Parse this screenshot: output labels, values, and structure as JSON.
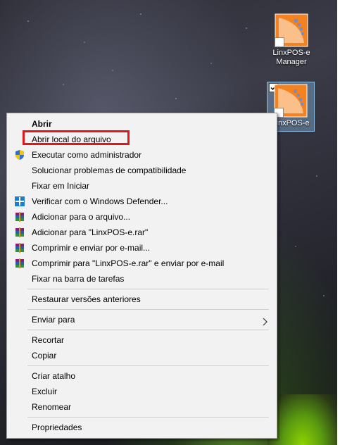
{
  "desktop": {
    "icons": [
      {
        "label_line1": "LinxPOS-e",
        "label_line2": "Manager",
        "icon": "linxpos-app-icon"
      },
      {
        "label_line1": "LinxPOS-e",
        "icon": "linxpos-app-icon",
        "selected": true
      }
    ]
  },
  "context_menu": {
    "items": [
      {
        "label": "Abrir",
        "bold": true
      },
      {
        "label": "Abrir local do arquivo",
        "highlighted": true
      },
      {
        "label": "Executar como administrador",
        "icon": "uac-shield-icon"
      },
      {
        "label": "Solucionar problemas de compatibilidade"
      },
      {
        "label": "Fixar em Iniciar"
      },
      {
        "label": "Verificar com o Windows Defender...",
        "icon": "windows-defender-icon"
      },
      {
        "label": "Adicionar para o arquivo...",
        "icon": "winrar-icon"
      },
      {
        "label": "Adicionar para \"LinxPOS-e.rar\"",
        "icon": "winrar-icon"
      },
      {
        "label": "Comprimir e enviar por e-mail...",
        "icon": "winrar-icon"
      },
      {
        "label": "Comprimir para \"LinxPOS-e.rar\" e enviar por e-mail",
        "icon": "winrar-icon"
      },
      {
        "label": "Fixar na barra de tarefas"
      },
      {
        "label": "Restaurar versões anteriores"
      },
      {
        "label": "Enviar para",
        "submenu": true,
        "icon": "chevron-right-icon"
      },
      {
        "label": "Recortar"
      },
      {
        "label": "Copiar"
      },
      {
        "label": "Criar atalho"
      },
      {
        "label": "Excluir"
      },
      {
        "label": "Renomear"
      },
      {
        "label": "Propriedades"
      }
    ]
  },
  "colors": {
    "highlight_border": "#e0161c",
    "menu_background": "#f2f2f2",
    "icon_orange": "#f58220"
  }
}
